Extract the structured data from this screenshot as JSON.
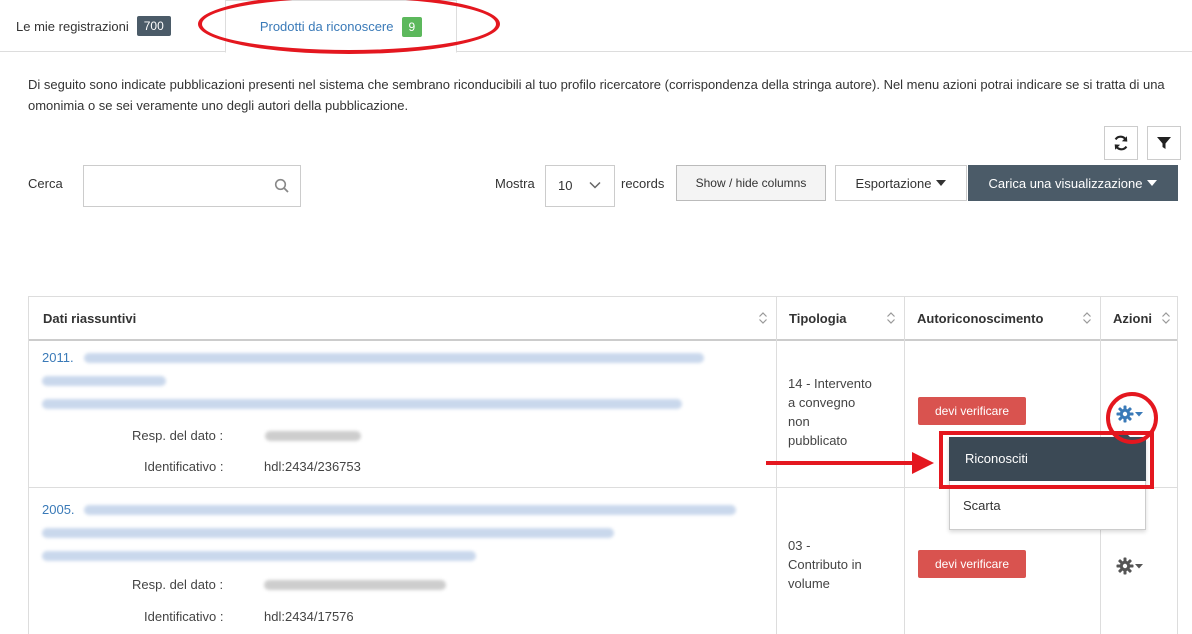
{
  "tabs": [
    {
      "label": "Le mie registrazioni",
      "count": "700"
    },
    {
      "label": "Prodotti da riconoscere",
      "count": "9"
    }
  ],
  "intro_text": "Di seguito sono indicate pubblicazioni presenti nel sistema che sembrano riconducibili al tuo profilo ricercatore (corrispondenza della stringa autore). Nel menu azioni potrai indicare se si tratta di una omonimia o se sei veramente uno degli autori della pubblicazione.",
  "toolbar": {
    "search_label": "Cerca",
    "search_value": "",
    "show_label": "Mostra",
    "page_length": "10",
    "records_label": "records",
    "show_hide_columns": "Show / hide columns",
    "export_label": "Esportazione",
    "load_view_label": "Carica una visualizzazione"
  },
  "table": {
    "headers": [
      "Dati riassuntivi",
      "Tipologia",
      "Autoriconoscimento",
      "Azioni"
    ],
    "rows": [
      {
        "year": "2011.",
        "resp_label": "Resp. del dato :",
        "id_label": "Identificativo :",
        "identifier": "hdl:2434/236753",
        "tipologia": [
          "14 - Intervento",
          "a convegno",
          "non",
          "pubblicato"
        ],
        "status": "devi verificare"
      },
      {
        "year": "2005.",
        "resp_label": "Resp. del dato :",
        "id_label": "Identificativo :",
        "identifier": "hdl:2434/17576",
        "tipologia": [
          "03 -",
          "Contributo in",
          "volume"
        ],
        "status": "devi verificare"
      }
    ]
  },
  "actions_menu": {
    "items": [
      "Riconosciti",
      "Scarta"
    ],
    "highlighted": "Riconosciti"
  },
  "colors": {
    "accent": "#3a7ab8",
    "dark": "#4b5b68",
    "badge_green": "#5cb85c",
    "danger": "#d9534f",
    "annotation_red": "#e4171f"
  }
}
